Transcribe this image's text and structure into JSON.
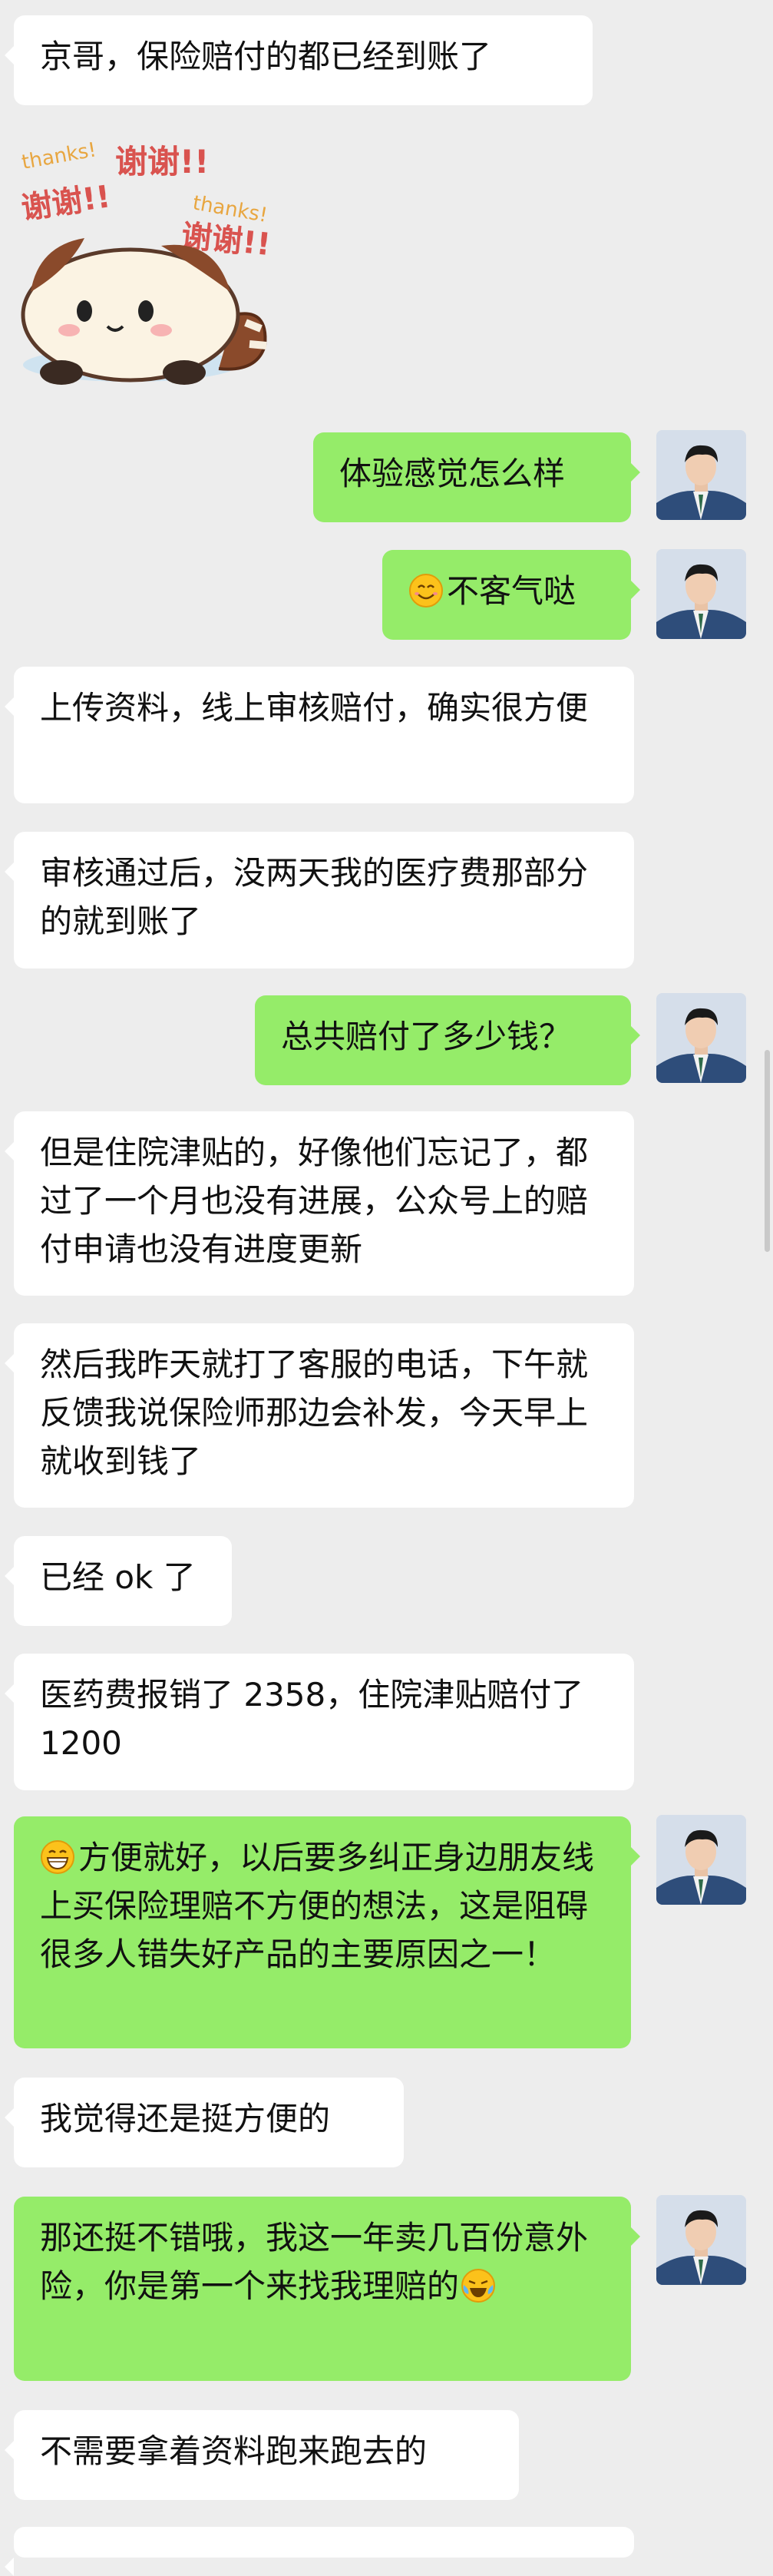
{
  "messages": [
    {
      "side": "in",
      "text": "京哥，保险赔付的都已经到账了"
    },
    {
      "side": "in",
      "type": "sticker",
      "sticker": {
        "words": [
          "thanks!",
          "谢谢!!",
          "谢谢!!",
          "thanks!",
          "谢谢!!"
        ],
        "icon": "raccoon-thanks-sticker"
      }
    },
    {
      "side": "out",
      "text": "体验感觉怎么样"
    },
    {
      "side": "out",
      "emoji": "smile-emoji",
      "text": "不客气哒"
    },
    {
      "side": "in",
      "text": "上传资料，线上审核赔付，确实很方便"
    },
    {
      "side": "in",
      "text": "审核通过后，没两天我的医疗费那部分的就到账了"
    },
    {
      "side": "out",
      "text": "总共赔付了多少钱？"
    },
    {
      "side": "in",
      "text": "但是住院津贴的，好像他们忘记了，都过了一个月也没有进展，公众号上的赔付申请也没有进度更新"
    },
    {
      "side": "in",
      "text": "然后我昨天就打了客服的电话，下午就反馈我说保险师那边会补发，今天早上就收到钱了"
    },
    {
      "side": "in",
      "text": "已经 ok 了"
    },
    {
      "side": "in",
      "text": "医药费报销了 2358，住院津贴赔付了 1200"
    },
    {
      "side": "out",
      "emoji": "grin-emoji",
      "text": "方便就好，以后要多纠正身边朋友线上买保险理赔不方便的想法，这是阻碍很多人错失好产品的主要原因之一！"
    },
    {
      "side": "in",
      "text": "我觉得还是挺方便的"
    },
    {
      "side": "out",
      "text": "那还挺不错哦，我这一年卖几百份意外险，你是第一个来找我理赔的",
      "emoji_after": "cry-laugh-emoji"
    },
    {
      "side": "in",
      "text": "不需要拿着资料跑来跑去的"
    }
  ],
  "colors": {
    "background": "#ededed",
    "incoming": "#ffffff",
    "outgoing": "#95ec69"
  }
}
